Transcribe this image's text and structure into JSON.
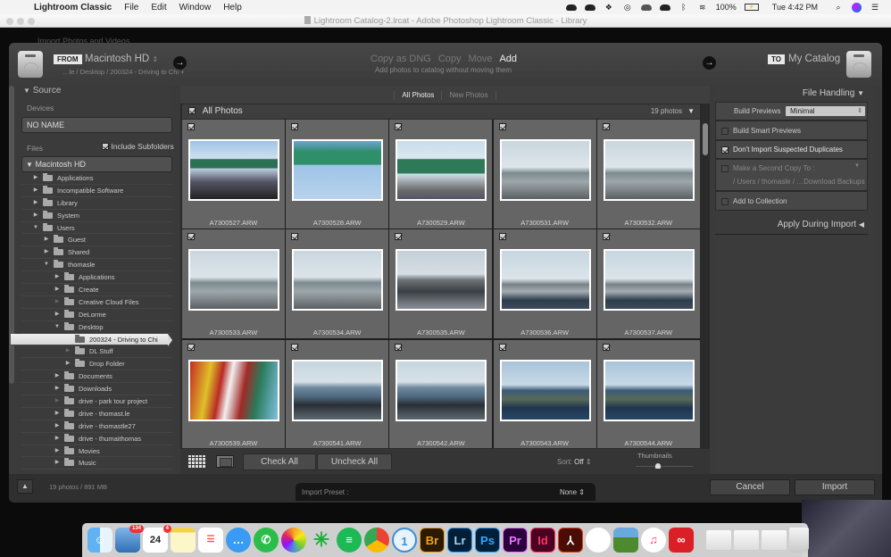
{
  "menubar": {
    "app_name": "Lightroom Classic",
    "menus": [
      "File",
      "Edit",
      "Window",
      "Help"
    ],
    "battery": "100%",
    "clock": "Tue 4:42 PM"
  },
  "window": {
    "title": "Lightroom Catalog-2.lrcat - Adobe Photoshop Lightroom Classic - Library",
    "behind_text": "Import Photos and Videos"
  },
  "import": {
    "from": {
      "tag": "FROM",
      "source": "Macintosh HD",
      "path": "…le / Desktop / 200324 - Driving to Chi +"
    },
    "modes": [
      {
        "label": "Copy as DNG",
        "active": false
      },
      {
        "label": "Copy",
        "active": false
      },
      {
        "label": "Move",
        "active": false
      },
      {
        "label": "Add",
        "active": true
      }
    ],
    "mode_description": "Add photos to catalog without moving them",
    "to": {
      "tag": "TO",
      "destination": "My Catalog"
    }
  },
  "source_panel": {
    "title": "Source",
    "devices_label": "Devices",
    "device": "NO NAME",
    "files_label": "Files",
    "include_subfolders": {
      "label": "Include Subfolders",
      "checked": true
    },
    "root": "Macintosh HD",
    "tree": [
      {
        "name": "Applications",
        "depth": 0,
        "state": "collapsed"
      },
      {
        "name": "Incompatible Software",
        "depth": 0,
        "state": "collapsed"
      },
      {
        "name": "Library",
        "depth": 0,
        "state": "collapsed"
      },
      {
        "name": "System",
        "depth": 0,
        "state": "collapsed"
      },
      {
        "name": "Users",
        "depth": 0,
        "state": "expanded"
      },
      {
        "name": "Guest",
        "depth": 1,
        "state": "collapsed"
      },
      {
        "name": "Shared",
        "depth": 1,
        "state": "collapsed"
      },
      {
        "name": "thomasle",
        "depth": 1,
        "state": "expanded"
      },
      {
        "name": "Applications",
        "depth": 2,
        "state": "collapsed"
      },
      {
        "name": "Create",
        "depth": 2,
        "state": "collapsed"
      },
      {
        "name": "Creative Cloud Files",
        "depth": 2,
        "state": "empty"
      },
      {
        "name": "DeLorme",
        "depth": 2,
        "state": "collapsed"
      },
      {
        "name": "Desktop",
        "depth": 2,
        "state": "expanded"
      },
      {
        "name": "200324 - Driving to Chi",
        "depth": 3,
        "state": "selected"
      },
      {
        "name": "DL Stuff",
        "depth": 3,
        "state": "empty"
      },
      {
        "name": "Drop Folder",
        "depth": 3,
        "state": "collapsed"
      },
      {
        "name": "Documents",
        "depth": 2,
        "state": "collapsed"
      },
      {
        "name": "Downloads",
        "depth": 2,
        "state": "collapsed"
      },
      {
        "name": "drive - park tour project",
        "depth": 2,
        "state": "empty"
      },
      {
        "name": "drive - thomast.le",
        "depth": 2,
        "state": "collapsed"
      },
      {
        "name": "drive - thomastle27",
        "depth": 2,
        "state": "collapsed"
      },
      {
        "name": "drive - thumaithomas",
        "depth": 2,
        "state": "collapsed"
      },
      {
        "name": "Movies",
        "depth": 2,
        "state": "collapsed"
      },
      {
        "name": "Music",
        "depth": 2,
        "state": "collapsed"
      }
    ]
  },
  "center": {
    "tabs": [
      {
        "label": "All Photos",
        "active": true
      },
      {
        "label": "New Photos",
        "active": false
      }
    ],
    "group_title": "All Photos",
    "group_count": "19 photos",
    "photos": [
      {
        "file": "A7300527.ARW",
        "checked": true,
        "scene": "signs-dark"
      },
      {
        "file": "A7300528.ARW",
        "checked": true,
        "scene": "signs-sky"
      },
      {
        "file": "A7300529.ARW",
        "checked": true,
        "scene": "signs-wide"
      },
      {
        "file": "A7300531.ARW",
        "checked": true,
        "scene": "highway"
      },
      {
        "file": "A7300532.ARW",
        "checked": true,
        "scene": "highway"
      },
      {
        "file": "A7300533.ARW",
        "checked": true,
        "scene": "highway"
      },
      {
        "file": "A7300534.ARW",
        "checked": true,
        "scene": "highway"
      },
      {
        "file": "A7300535.ARW",
        "checked": true,
        "scene": "highway-cars"
      },
      {
        "file": "A7300536.ARW",
        "checked": true,
        "scene": "highway-dash"
      },
      {
        "file": "A7300537.ARW",
        "checked": true,
        "scene": "highway-dash"
      },
      {
        "file": "A7300539.ARW",
        "checked": true,
        "scene": "mural"
      },
      {
        "file": "A7300541.ARW",
        "checked": true,
        "scene": "skyline-traffic"
      },
      {
        "file": "A7300542.ARW",
        "checked": true,
        "scene": "skyline-traffic"
      },
      {
        "file": "A7300543.ARW",
        "checked": true,
        "scene": "skyline"
      },
      {
        "file": "A7300544.ARW",
        "checked": true,
        "scene": "skyline"
      }
    ],
    "toolbar": {
      "check_all": "Check All",
      "uncheck_all": "Uncheck All",
      "sort_label": "Sort:",
      "sort_value": "Off",
      "thumbnails_label": "Thumbnails"
    }
  },
  "file_handling": {
    "title": "File Handling",
    "build_previews_label": "Build Previews",
    "build_previews_value": "Minimal",
    "build_smart_previews": {
      "label": "Build Smart Previews",
      "checked": false
    },
    "dont_import_duplicates": {
      "label": "Don't Import Suspected Duplicates",
      "checked": true
    },
    "second_copy": {
      "label": "Make a Second Copy To :",
      "path": "/ Users / thomasle / …Download Backups",
      "checked": false
    },
    "add_to_collection": {
      "label": "Add to Collection",
      "checked": false
    },
    "apply_during_import": "Apply During Import"
  },
  "footer": {
    "summary": "19 photos / 891 MB",
    "import_preset_label": "Import Preset :",
    "import_preset_value": "None",
    "cancel": "Cancel",
    "import": "Import"
  },
  "dock": {
    "apps": [
      {
        "name": "Finder",
        "icon": "finder-icon"
      },
      {
        "name": "Mail",
        "icon": "mail-icon",
        "badge": "134"
      },
      {
        "name": "Calendar",
        "icon": "calendar-icon",
        "badge": "4",
        "month": "MAR",
        "day": "24"
      },
      {
        "name": "Notes",
        "icon": "notes-icon"
      },
      {
        "name": "Reminders",
        "icon": "reminders-icon"
      },
      {
        "name": "Messages",
        "icon": "messages-icon"
      },
      {
        "name": "WhatsApp",
        "icon": "whatsapp-icon"
      },
      {
        "name": "Photos",
        "icon": "photos-icon"
      },
      {
        "name": "Perplexity",
        "icon": "asterisk-icon"
      },
      {
        "name": "Spotify",
        "icon": "spotify-icon"
      },
      {
        "name": "Chrome",
        "icon": "chrome-icon"
      },
      {
        "name": "1Password",
        "icon": "onepassword-icon",
        "glyph": "1"
      },
      {
        "name": "Bridge",
        "icon": "bridge-icon",
        "glyph": "Br"
      },
      {
        "name": "Lightroom Classic",
        "icon": "lightroom-icon",
        "glyph": "Lr"
      },
      {
        "name": "Photoshop",
        "icon": "photoshop-icon",
        "glyph": "Ps"
      },
      {
        "name": "Premiere Pro",
        "icon": "premiere-icon",
        "glyph": "Pr"
      },
      {
        "name": "InDesign",
        "icon": "indesign-icon",
        "glyph": "Id"
      },
      {
        "name": "Acrobat",
        "icon": "acrobat-icon"
      },
      {
        "name": "Slack",
        "icon": "slack-icon"
      },
      {
        "name": "Preview",
        "icon": "preview-icon"
      },
      {
        "name": "Music",
        "icon": "music-icon"
      },
      {
        "name": "Creative Cloud",
        "icon": "creative-cloud-icon"
      }
    ],
    "recents": [
      "recent-window-1",
      "recent-window-2",
      "recent-window-3"
    ],
    "trash": "trash-icon"
  }
}
